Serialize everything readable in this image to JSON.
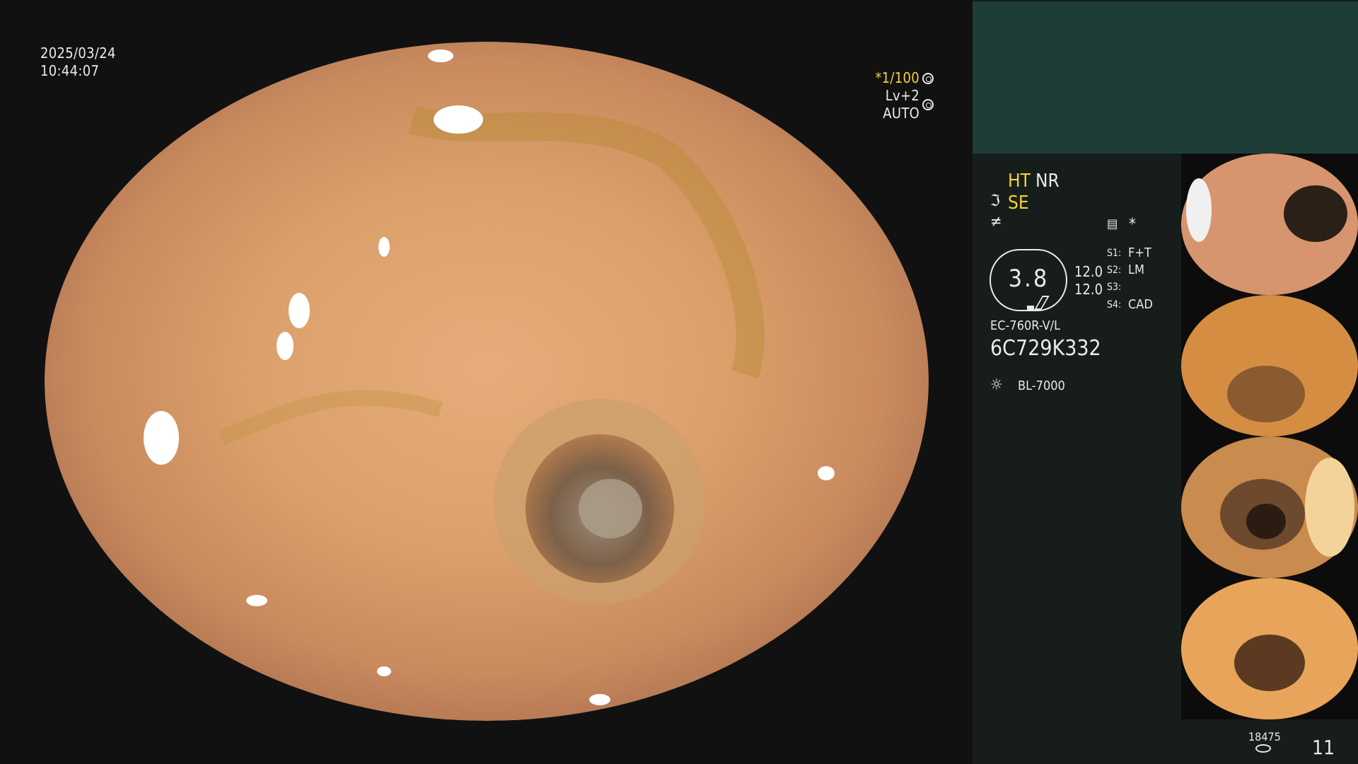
{
  "overlay": {
    "date": "2025/03/24",
    "time": "10:44:07",
    "shutter": "*1/100",
    "level": "Lv+2 AUTO"
  },
  "panel": {
    "mode1": "HT",
    "mode2": "NR",
    "mode3": "SE",
    "ring_value": "3.8",
    "val_a": "12.0",
    "val_b": "12.0",
    "s1_label": "S1:",
    "s1_value": "F+T",
    "s2_label": "S2:",
    "s2_value": "LM",
    "s3_label": "S3:",
    "s3_value": "",
    "s4_label": "S4:",
    "s4_value": "CAD",
    "scope_model": "EC-760R-V/L",
    "serial": "6C729K332",
    "light_source": "BL-7000",
    "storage_count": "18475",
    "image_count": "11"
  },
  "icons": [
    "shutter-icon",
    "auto-icon",
    "scope-icon",
    "enhance-icon",
    "memo-icon",
    "asterisk-icon",
    "light-icon",
    "disk-icon"
  ],
  "colors": {
    "accent_yellow": "#f2d23c",
    "panel_bg": "#161d1b",
    "top_block": "#1f3d37"
  }
}
